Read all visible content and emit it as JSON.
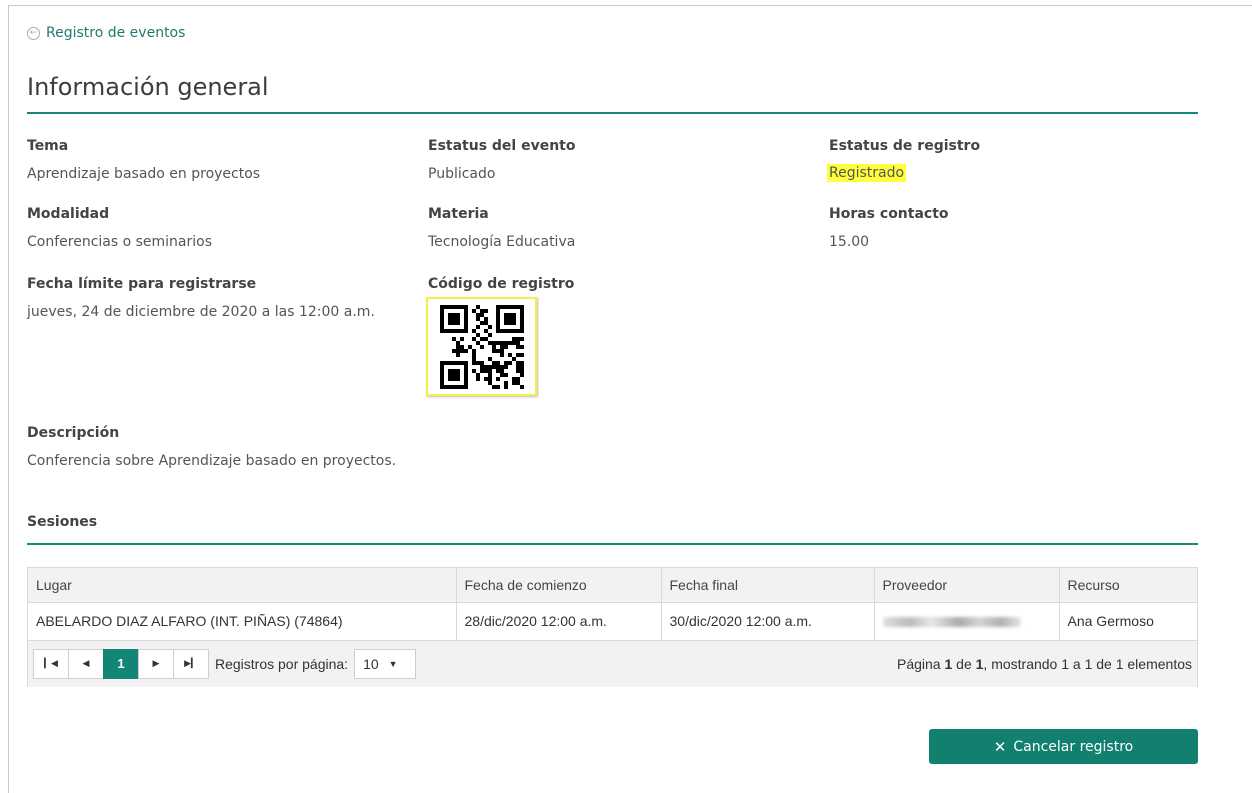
{
  "breadcrumb": {
    "back_label": "Registro de eventos"
  },
  "page_title": "Información general",
  "fields": {
    "tema": {
      "label": "Tema",
      "value": "Aprendizaje basado en proyectos"
    },
    "estatus_evento": {
      "label": "Estatus del evento",
      "value": "Publicado"
    },
    "estatus_registro": {
      "label": "Estatus de registro",
      "value": "Registrado"
    },
    "modalidad": {
      "label": "Modalidad",
      "value": "Conferencias o seminarios"
    },
    "materia": {
      "label": "Materia",
      "value": "Tecnología Educativa"
    },
    "horas_contacto": {
      "label": "Horas contacto",
      "value": "15.00"
    },
    "fecha_limite": {
      "label": "Fecha límite para registrarse",
      "value": "jueves, 24 de diciembre de 2020 a las 12:00 a.m."
    },
    "codigo_registro": {
      "label": "Código de registro"
    },
    "descripcion": {
      "label": "Descripción",
      "value": "Conferencia sobre Aprendizaje basado en proyectos."
    }
  },
  "sessions": {
    "title": "Sesiones",
    "columns": [
      "Lugar",
      "Fecha de comienzo",
      "Fecha final",
      "Proveedor",
      "Recurso"
    ],
    "rows": [
      {
        "lugar": "ABELARDO DIAZ ALFARO (INT. PIÑAS) (74864)",
        "inicio": "28/dic/2020 12:00 a.m.",
        "final": "30/dic/2020 12:00 a.m.",
        "recurso": "Ana Germoso"
      }
    ],
    "pager": {
      "current_page": "1",
      "per_page_label": "Registros por página:",
      "per_page_value": "10",
      "info_prefix": "Página ",
      "info_page": "1",
      "info_mid": " de ",
      "info_total": "1",
      "info_suffix": ", mostrando 1 a 1 de 1 elementos"
    }
  },
  "actions": {
    "cancel_label": "Cancelar registro"
  },
  "colors": {
    "accent": "#17897a",
    "button": "#12806f",
    "highlight": "#ffff3d"
  }
}
